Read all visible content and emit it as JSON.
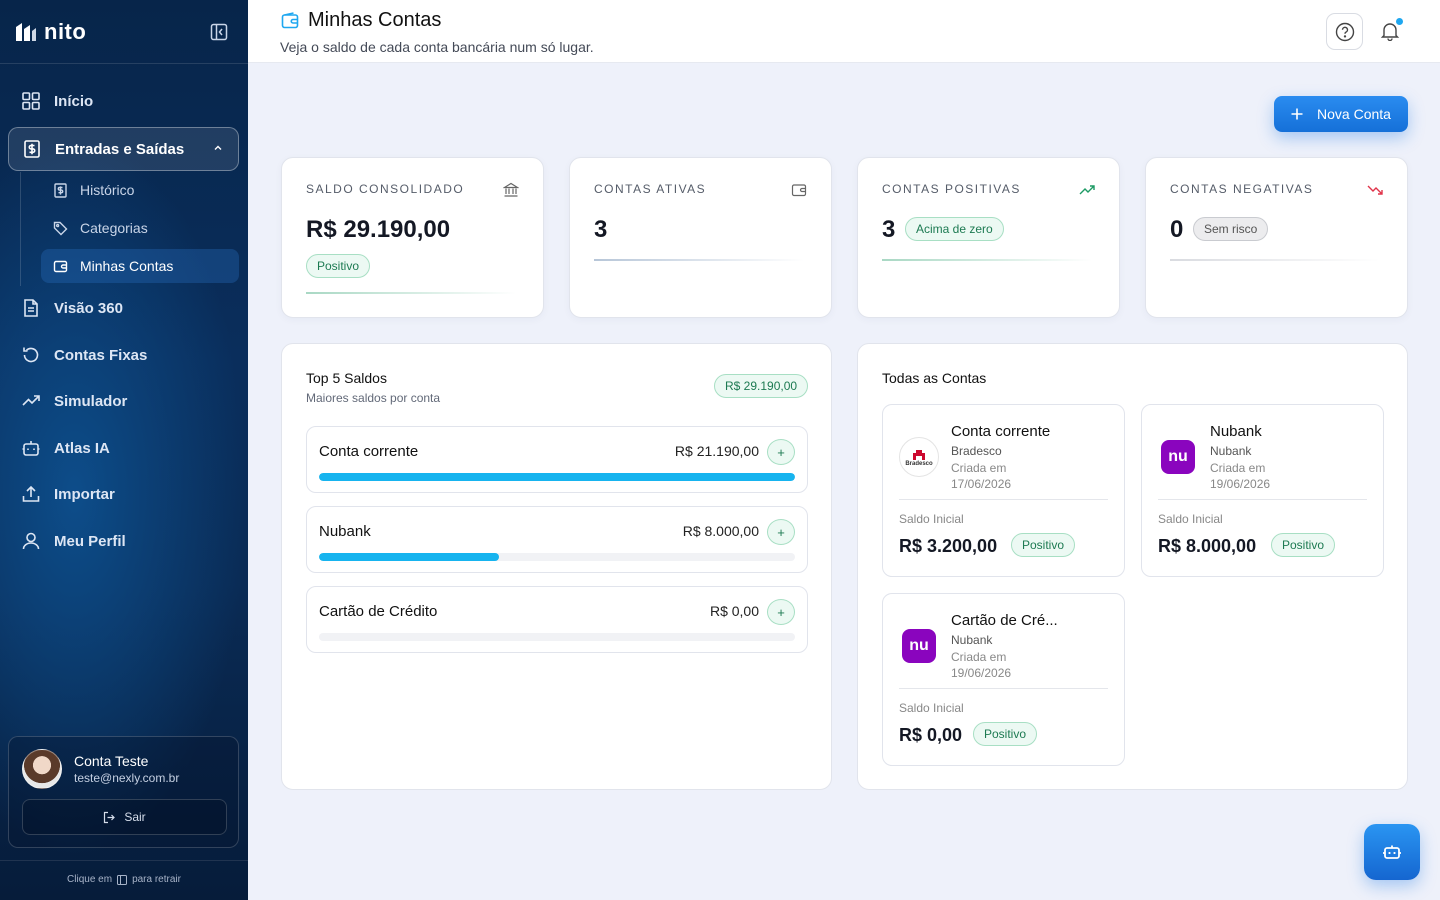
{
  "sidebar": {
    "logo_text": "nito",
    "nav": [
      {
        "label": "Início",
        "icon": "grid-icon"
      },
      {
        "label": "Entradas e Saídas",
        "icon": "dollar-doc-icon"
      },
      {
        "label": "Visão 360",
        "icon": "file-icon"
      },
      {
        "label": "Contas Fixas",
        "icon": "history-icon"
      },
      {
        "label": "Simulador",
        "icon": "trend-icon"
      },
      {
        "label": "Atlas IA",
        "icon": "bot-icon"
      },
      {
        "label": "Importar",
        "icon": "upload-icon"
      },
      {
        "label": "Meu Perfil",
        "icon": "user-icon"
      }
    ],
    "sub": [
      {
        "label": "Histórico"
      },
      {
        "label": "Categorias"
      },
      {
        "label": "Minhas Contas"
      }
    ],
    "user": {
      "name": "Conta Teste",
      "email": "teste@nexly.com.br",
      "logout": "Sair"
    },
    "footer_before": "Clique em",
    "footer_after": "para retrair"
  },
  "header": {
    "title": "Minhas Contas",
    "subtitle": "Veja o saldo de cada conta bancária num só lugar."
  },
  "new_account_label": "Nova Conta",
  "kpis": [
    {
      "label": "SALDO CONSOLIDADO",
      "value": "R$ 29.190,00",
      "badge": "Positivo"
    },
    {
      "label": "CONTAS ATIVAS",
      "value": "3"
    },
    {
      "label": "CONTAS POSITIVAS",
      "value": "3",
      "badge": "Acima de zero"
    },
    {
      "label": "CONTAS NEGATIVAS",
      "value": "0",
      "badge": "Sem risco"
    }
  ],
  "top5": {
    "title": "Top 5 Saldos",
    "subtitle": "Maiores saldos por conta",
    "total": "R$ 29.190,00",
    "rows": [
      {
        "name": "Conta corrente",
        "amount": "R$ 21.190,00",
        "share": 1.0
      },
      {
        "name": "Nubank",
        "amount": "R$ 8.000,00",
        "share": 0.378
      },
      {
        "name": "Cartão de Crédito",
        "amount": "R$ 0,00",
        "share": 0.0
      }
    ]
  },
  "all_accounts": {
    "title": "Todas as Contas",
    "accounts": [
      {
        "name": "Conta corrente",
        "bank": "Bradesco",
        "created_label": "Criada em",
        "created": "17/06/2026",
        "init_label": "Saldo Inicial",
        "init_value": "R$ 3.200,00",
        "status": "Positivo",
        "logo_text": "Bradesco"
      },
      {
        "name": "Nubank",
        "bank": "Nubank",
        "created_label": "Criada em",
        "created": "19/06/2026",
        "init_label": "Saldo Inicial",
        "init_value": "R$ 8.000,00",
        "status": "Positivo",
        "logo_text": "nu"
      },
      {
        "name": "Cartão de Cré...",
        "bank": "Nubank",
        "created_label": "Criada em",
        "created": "19/06/2026",
        "init_label": "Saldo Inicial",
        "init_value": "R$ 0,00",
        "status": "Positivo",
        "logo_text": "nu"
      }
    ]
  },
  "colors": {
    "accent": "#1ea7f0",
    "brand_blue": "#1570d8",
    "sidebar_bg": "#0a2e5c",
    "positive": "#1d7a52",
    "nubank": "#8a05be",
    "bradesco": "#cc092f"
  }
}
